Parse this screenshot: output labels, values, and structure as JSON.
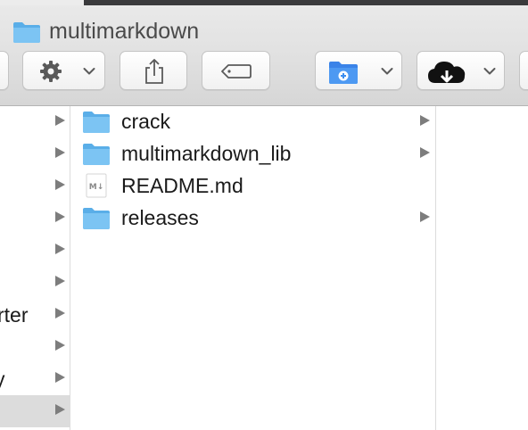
{
  "window": {
    "title": "multimarkdown"
  },
  "toolbar": {
    "buttons": [
      {
        "name": "back-forward",
        "icon": "partial-button"
      },
      {
        "name": "action",
        "icon": "gear-icon",
        "dropdown": true
      },
      {
        "name": "share",
        "icon": "share-icon"
      },
      {
        "name": "tags",
        "icon": "tag-icon"
      },
      {
        "name": "new-folder",
        "icon": "folder-add-icon",
        "dropdown": true
      },
      {
        "name": "cloud",
        "icon": "cloud-icon",
        "dropdown": true
      }
    ]
  },
  "left_column": {
    "rows": [
      {
        "label": "",
        "has_children": true
      },
      {
        "label": "",
        "has_children": true
      },
      {
        "label": "",
        "has_children": true
      },
      {
        "label": "",
        "has_children": true
      },
      {
        "label": "",
        "has_children": true
      },
      {
        "label": "",
        "has_children": true
      },
      {
        "label": "rter",
        "has_children": true
      },
      {
        "label": "",
        "has_children": true
      },
      {
        "label": "y",
        "has_children": true
      },
      {
        "label": "",
        "has_children": true,
        "selected": true
      }
    ]
  },
  "middle_column": {
    "items": [
      {
        "name": "crack",
        "kind": "folder",
        "has_children": true
      },
      {
        "name": "multimarkdown_lib",
        "kind": "folder",
        "has_children": true
      },
      {
        "name": "README.md",
        "kind": "markdown-file",
        "has_children": false
      },
      {
        "name": "releases",
        "kind": "folder",
        "has_children": true
      }
    ]
  },
  "file_icon": {
    "md_glyph": "M↓"
  },
  "colors": {
    "folder_blue": "#7cc4f3",
    "folder_blue_dark": "#5aaee8",
    "accent_blue": "#3c8ef0",
    "selection_gray": "#dcdcdc"
  }
}
